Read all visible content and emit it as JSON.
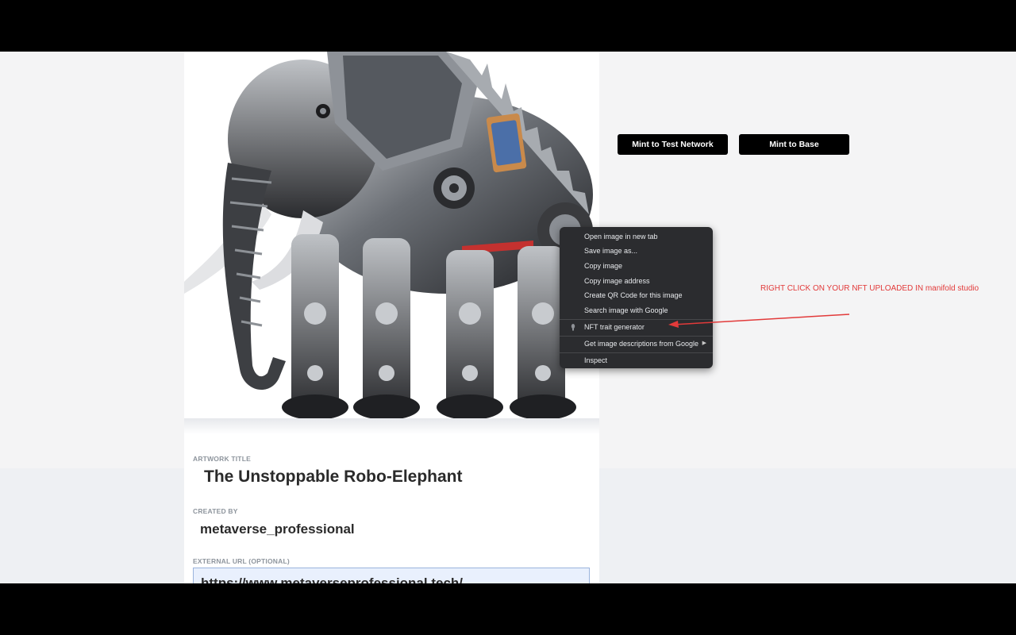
{
  "buttons": {
    "mint_test": "Mint to Test Network",
    "mint_base": "Mint to Base"
  },
  "form": {
    "title_label": "ARTWORK TITLE",
    "title_value": "The Unstoppable Robo-Elephant",
    "creator_label": "CREATED BY",
    "creator_value": "metaverse_professional",
    "url_label": "EXTERNAL URL (OPTIONAL)",
    "url_value": "https://www.metaverseprofessional.tech/"
  },
  "context_menu": {
    "items": [
      "Open image in new tab",
      "Save image as...",
      "Copy image",
      "Copy image address",
      "Create QR Code for this image",
      "Search image with Google",
      "NFT trait generator",
      "Get image descriptions from Google",
      "Inspect"
    ]
  },
  "annotation": {
    "text": "RIGHT CLICK ON YOUR NFT UPLOADED IN manifold studio",
    "color": "#e23a3a"
  },
  "colors": {
    "page_background": "#f4f4f5",
    "button": "#000000",
    "menu_background": "#2b2c2f"
  }
}
